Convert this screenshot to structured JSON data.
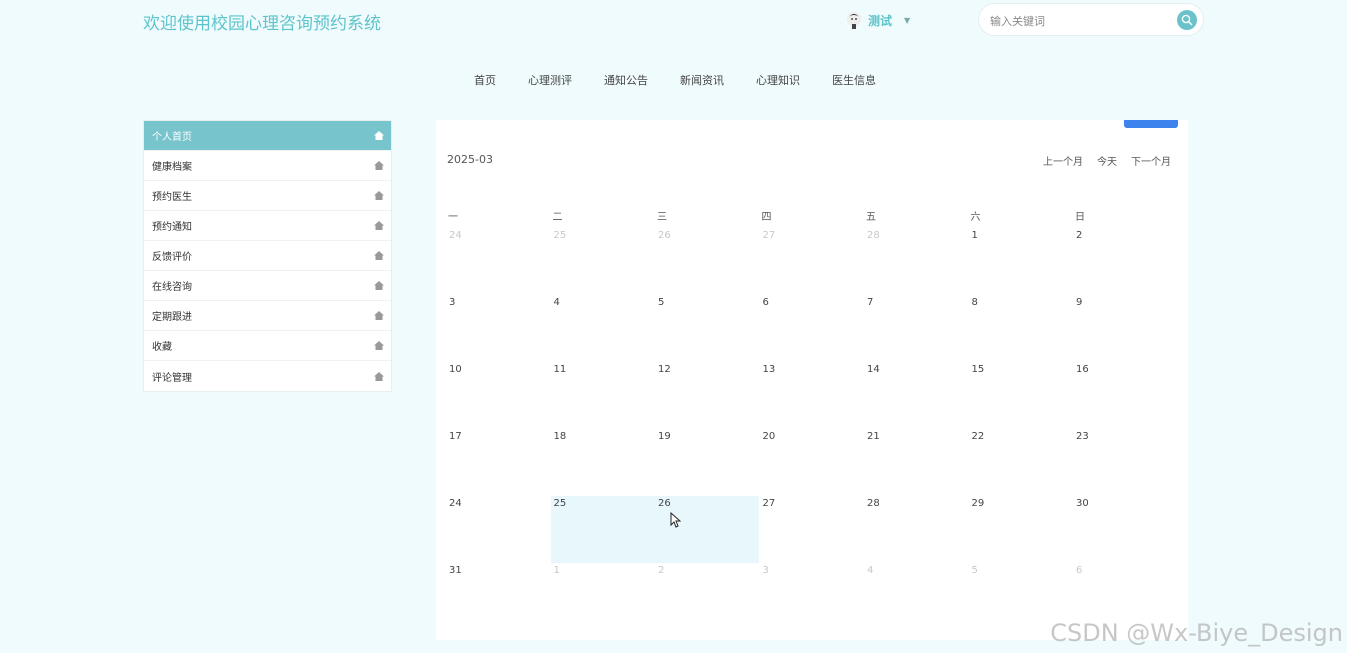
{
  "header": {
    "site_title": "欢迎使用校园心理咨询预约系统",
    "user_name": "测试",
    "search_placeholder": "输入关键词"
  },
  "nav": {
    "items": [
      "首页",
      "心理测评",
      "通知公告",
      "新闻资讯",
      "心理知识",
      "医生信息"
    ]
  },
  "sidebar": {
    "items": [
      {
        "label": "个人首页",
        "active": true
      },
      {
        "label": "健康档案"
      },
      {
        "label": "预约医生"
      },
      {
        "label": "预约通知"
      },
      {
        "label": "反馈评价"
      },
      {
        "label": "在线咨询"
      },
      {
        "label": "定期跟进"
      },
      {
        "label": "收藏"
      },
      {
        "label": "评论管理"
      }
    ]
  },
  "calendar": {
    "title": "2025-03",
    "prev_label": "上一个月",
    "today_label": "今天",
    "next_label": "下一个月",
    "weekdays": [
      "一",
      "二",
      "三",
      "四",
      "五",
      "六",
      "日"
    ],
    "weeks": [
      [
        "24",
        "25",
        "26",
        "27",
        "28",
        "1",
        "2"
      ],
      [
        "3",
        "4",
        "5",
        "6",
        "7",
        "8",
        "9"
      ],
      [
        "10",
        "11",
        "12",
        "13",
        "14",
        "15",
        "16"
      ],
      [
        "17",
        "18",
        "19",
        "20",
        "21",
        "22",
        "23"
      ],
      [
        "24",
        "25",
        "26",
        "27",
        "28",
        "29",
        "30"
      ],
      [
        "31",
        "1",
        "2",
        "3",
        "4",
        "5",
        "6"
      ]
    ],
    "other_month": [
      [
        true,
        true,
        true,
        true,
        true,
        false,
        false
      ],
      [
        false,
        false,
        false,
        false,
        false,
        false,
        false
      ],
      [
        false,
        false,
        false,
        false,
        false,
        false,
        false
      ],
      [
        false,
        false,
        false,
        false,
        false,
        false,
        false
      ],
      [
        false,
        false,
        false,
        false,
        false,
        false,
        false
      ],
      [
        false,
        true,
        true,
        true,
        true,
        true,
        true
      ]
    ],
    "highlighted": [
      [
        4,
        1
      ],
      [
        4,
        2
      ]
    ]
  },
  "watermark": "CSDN @Wx-Biye_Design",
  "colors": {
    "accent": "#5ec4cc",
    "sidebar_active": "#77c4cc",
    "page_bg": "#f0fbfd",
    "highlight": "#e8f7fb",
    "blue_tab": "#3c83ee"
  }
}
